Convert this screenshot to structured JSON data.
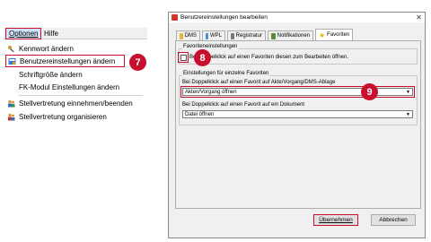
{
  "menu": {
    "top": [
      "Optionen",
      "Hilfe"
    ],
    "items": [
      {
        "label": "Kennwort ändern",
        "icon": "key-icon"
      },
      {
        "label": "Benutzereinstellungen ändern",
        "icon": "user-settings-icon"
      },
      {
        "label": "Schriftgröße ändern",
        "icon": ""
      },
      {
        "label": "FK-Modul Einstellungen ändern",
        "icon": ""
      },
      {
        "label": "Stellvertretung einnehmen/beenden",
        "icon": "users-swap-icon"
      },
      {
        "label": "Stellvertretung organisieren",
        "icon": "users-organize-icon"
      }
    ]
  },
  "badges": {
    "b7": "7",
    "b8": "8",
    "b9": "9"
  },
  "dialog": {
    "title": "Benutzereinstellungen bearbeiten",
    "tabs": [
      "DMS",
      "WPL",
      "Registratur",
      "Notifikationen",
      "Favoriten"
    ],
    "group1_title": "Favoriteneinstellungen",
    "checkbox_label": "Bei Doppelklick auf einen Favoriten diesen zum Bearbeiten öffnen.",
    "group2_title": "Einstellungen für einzelne Favoriten",
    "label1": "Bei Doppelklick auf einen Favorit auf Akte/Vorgang/DMS-Ablage",
    "select1_value": "Akten/Vorgang öffnen",
    "label2": "Bei Doppelklick auf einen Favorit auf ein Dokument",
    "select2_value": "Datei öffnen",
    "ok_label": "Übernehmen",
    "cancel_label": "Abbrechen"
  },
  "colors": {
    "accent_red": "#c8102e",
    "selected_field": "#fff0f0"
  }
}
